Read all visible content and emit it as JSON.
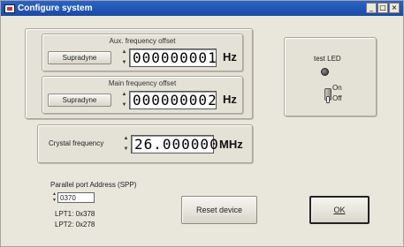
{
  "window": {
    "title": "Configure system"
  },
  "titlebar": {
    "minimize": "_",
    "maximize": "□",
    "close": "×"
  },
  "aux": {
    "label": "Aux. frequency offset",
    "button": "Supradyne",
    "value": "000000001",
    "unit": "Hz"
  },
  "main": {
    "label": "Main frequency offset",
    "button": "Supradyne",
    "value": "000000002",
    "unit": "Hz"
  },
  "crystal": {
    "label": "Crystal frequency",
    "value": "26.000000",
    "unit": "MHz"
  },
  "led_panel": {
    "label": "test LED",
    "on": "On",
    "off": "Off"
  },
  "parallel": {
    "label": "Parallel port Address (SPP)",
    "value": "0370",
    "lpt1": "LPT1: 0x378",
    "lpt2": "LPT2: 0x278"
  },
  "actions": {
    "reset": "Reset device",
    "ok": "OK"
  },
  "colors": {
    "titlebar": "#1c4aa4",
    "panel": "#e4e1d7",
    "led_off": "#333333"
  }
}
